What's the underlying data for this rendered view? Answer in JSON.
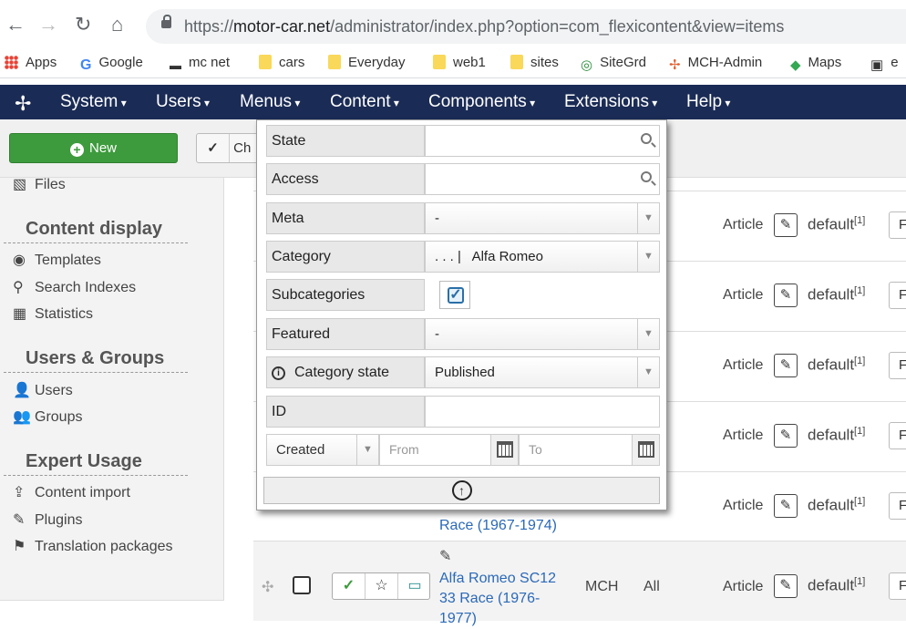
{
  "browser": {
    "url_prefix": "https://",
    "url_domain": "motor-car.net",
    "url_rest": "/administrator/index.php?option=com_flexicontent&view=items",
    "bookmarks": [
      {
        "label": "Apps",
        "icon": "apps-grid-icon"
      },
      {
        "label": "Google",
        "icon": "google-icon"
      },
      {
        "label": "mc net",
        "icon": "car-icon"
      },
      {
        "label": "cars",
        "icon": "folder-icon"
      },
      {
        "label": "Everyday",
        "icon": "folder-icon"
      },
      {
        "label": "web1",
        "icon": "folder-icon"
      },
      {
        "label": "sites",
        "icon": "folder-icon"
      },
      {
        "label": "SiteGrd",
        "icon": "sitegrd-icon"
      },
      {
        "label": "MCH-Admin",
        "icon": "joomla-icon"
      },
      {
        "label": "Maps",
        "icon": "maps-icon"
      },
      {
        "label": "e",
        "icon": "tv-icon"
      }
    ]
  },
  "nav": {
    "menus": [
      "System",
      "Users",
      "Menus",
      "Content",
      "Components",
      "Extensions",
      "Help"
    ]
  },
  "toolbar": {
    "new_label": "New",
    "check_label": "Ch"
  },
  "sidebar": {
    "files": "Files",
    "content_display": {
      "title": "Content display",
      "items": [
        "Templates",
        "Search Indexes",
        "Statistics"
      ]
    },
    "users_groups": {
      "title": "Users & Groups",
      "items": [
        "Users",
        "Groups"
      ]
    },
    "expert_usage": {
      "title": "Expert Usage",
      "items": [
        "Content import",
        "Plugins",
        "Translation packages"
      ]
    }
  },
  "rows": {
    "type": "Article",
    "template": "default",
    "template_sup": "[1]",
    "lang": "F",
    "partial_title": "Race (1967-1974)",
    "last": {
      "title_line1": "Alfa Romeo SC12",
      "title_line2": "33 Race (1976-",
      "title_line3": "1977)",
      "author": "MCH",
      "access": "All"
    }
  },
  "filter": {
    "state_label": "State",
    "access_label": "Access",
    "meta_label": "Meta",
    "meta_value": "-",
    "category_label": "Category",
    "category_value": ". . . |   Alfa Romeo",
    "subcategories_label": "Subcategories",
    "featured_label": "Featured",
    "featured_value": "-",
    "category_state_label": "Category state",
    "category_state_value": "Published",
    "id_label": "ID",
    "created_value": "Created",
    "from_placeholder": "From",
    "to_placeholder": "To"
  },
  "colors": {
    "nav_bg": "#1a2b55",
    "new_button": "#3d9b3d",
    "link": "#2a69b8"
  }
}
